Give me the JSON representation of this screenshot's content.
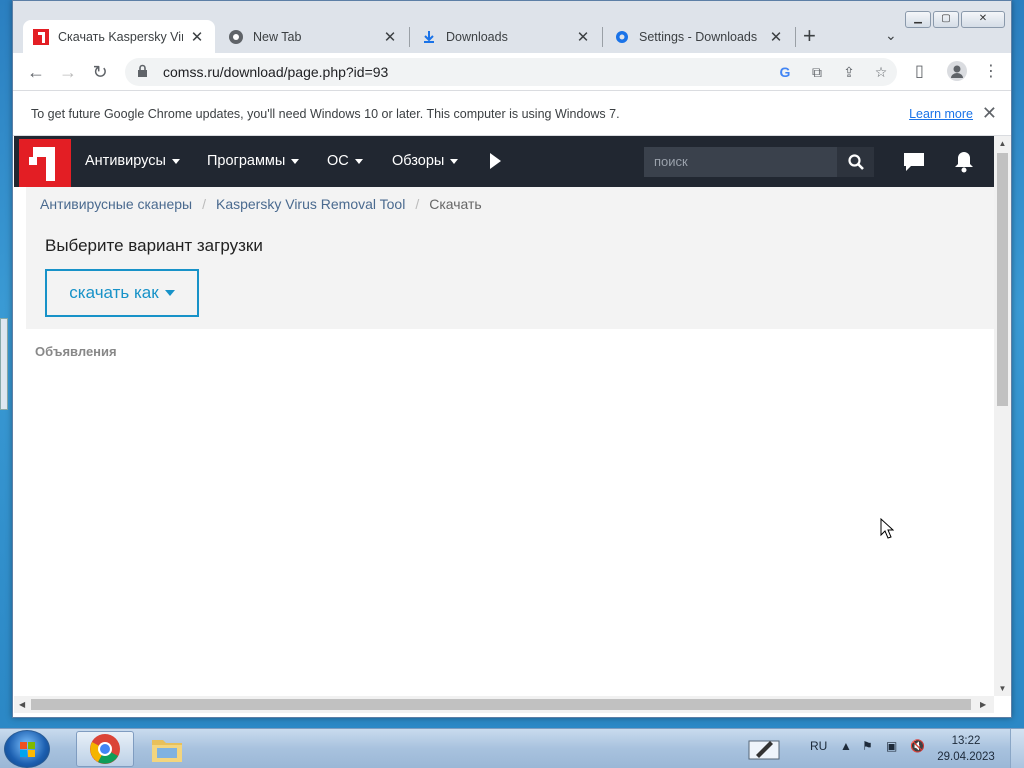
{
  "browser": {
    "tabs": [
      {
        "title": "Скачать Kaspersky Virus Removal Tool",
        "icon": "comss-favicon",
        "active": true
      },
      {
        "title": "New Tab",
        "icon": "chrome-icon",
        "active": false
      },
      {
        "title": "Downloads",
        "icon": "download-icon",
        "active": false
      },
      {
        "title": "Settings - Downloads",
        "icon": "gear-icon",
        "active": false
      }
    ],
    "url": "comss.ru/download/page.php?id=93",
    "infobar": {
      "message": "To get future Google Chrome updates, you'll need Windows 10 or later. This computer is using Windows 7.",
      "link": "Learn more"
    }
  },
  "site": {
    "nav": [
      {
        "label": "Антивирусы"
      },
      {
        "label": "Программы"
      },
      {
        "label": "ОС"
      },
      {
        "label": "Обзоры"
      }
    ],
    "search_placeholder": "поиск",
    "breadcrumb": [
      "Антивирусные сканеры",
      "Kaspersky Virus Removal Tool",
      "Скачать"
    ],
    "heading": "Выберите вариант загрузки",
    "download_button": "скачать как",
    "ads_label": "Объявления",
    "colors": {
      "brand_red": "#e31e24",
      "nav_bg": "#212731",
      "accent": "#1792c8"
    }
  },
  "taskbar": {
    "language": "RU",
    "time": "13:22",
    "date": "29.04.2023",
    "apps": [
      "chrome-icon",
      "explorer-icon"
    ]
  }
}
